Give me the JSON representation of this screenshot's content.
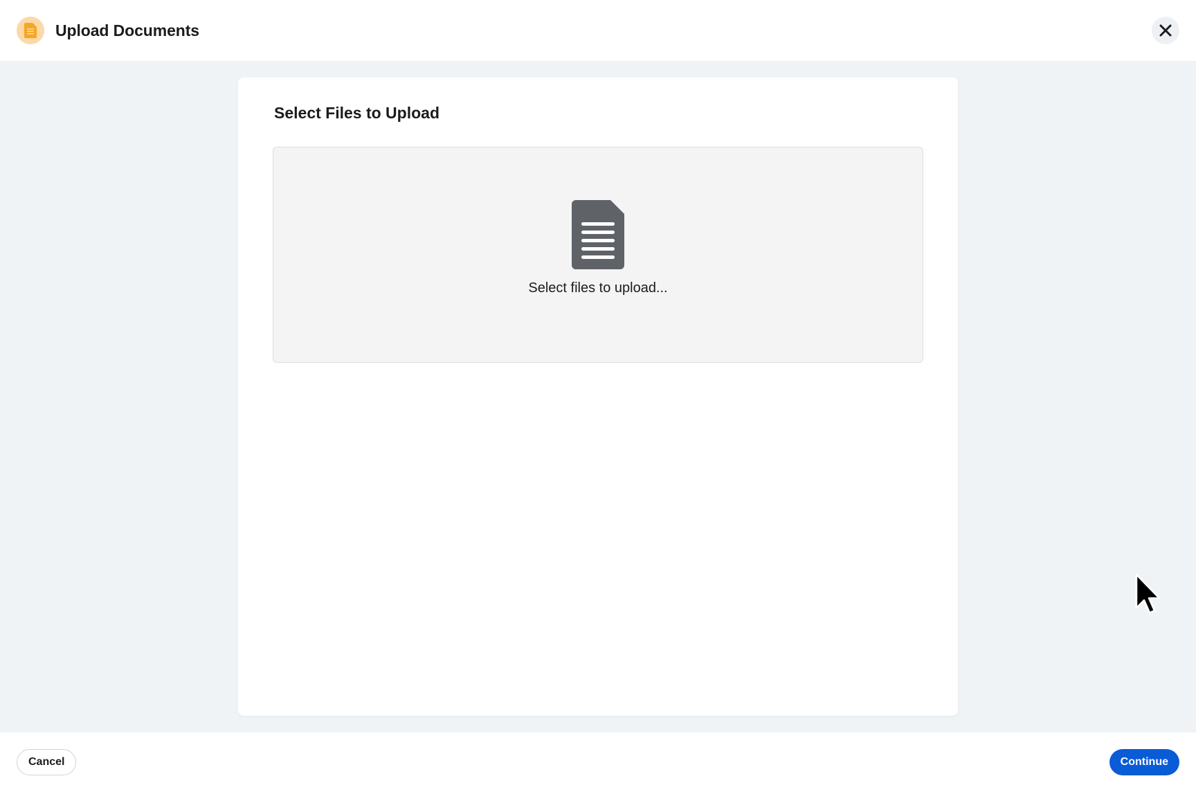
{
  "header": {
    "title": "Upload Documents",
    "icon": "document-icon",
    "icon_color": "#f5a623",
    "icon_bg": "#fbd9a8",
    "close_icon": "close-icon"
  },
  "main": {
    "card_title": "Select Files to Upload",
    "dropzone": {
      "icon": "document-icon",
      "icon_color": "#5f6368",
      "text": "Select files to upload..."
    }
  },
  "footer": {
    "cancel_label": "Cancel",
    "continue_label": "Continue",
    "continue_color": "#0a5bd6"
  },
  "colors": {
    "content_bg": "#f0f3f6",
    "card_bg": "#ffffff",
    "dropzone_bg": "#f4f4f4"
  }
}
